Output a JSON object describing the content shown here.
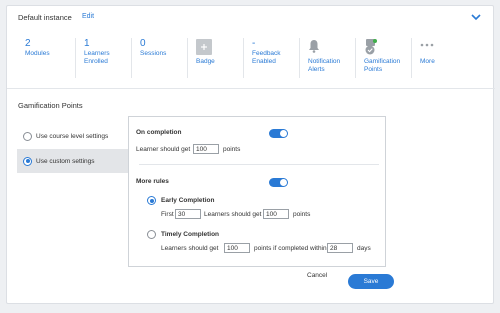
{
  "header": {
    "title": "Default instance",
    "edit_label": "Edit"
  },
  "stats": [
    {
      "value": "2",
      "label": "Modules"
    },
    {
      "value": "1",
      "label": "Learners Enrolled"
    },
    {
      "value": "0",
      "label": "Sessions"
    },
    {
      "icon": "badge-icon",
      "label": "Badge"
    },
    {
      "value": "-",
      "label": "Feedback Enabled"
    },
    {
      "icon": "bell-icon",
      "label": "Notification Alerts"
    },
    {
      "icon": "gamification-points-icon",
      "label": "Gamification Points"
    },
    {
      "icon": "more-dots-icon",
      "label": "More"
    }
  ],
  "section": {
    "title": "Gamification Points"
  },
  "left_options": [
    {
      "label": "Use course level settings",
      "selected": false
    },
    {
      "label": "Use custom settings",
      "selected": true
    }
  ],
  "panel": {
    "on_completion": {
      "title": "On completion",
      "enabled": true,
      "prefix": "Learner should get",
      "points_value": "100",
      "suffix": "points"
    },
    "more_rules": {
      "title": "More rules",
      "enabled": true,
      "early": {
        "title": "Early Completion",
        "selected": true,
        "first_label": "First",
        "first_value": "30",
        "mid_label": "Learners should get",
        "points_value": "100",
        "suffix": "points"
      },
      "timely": {
        "title": "Timely Completion",
        "selected": false,
        "prefix": "Learners should get",
        "points_value": "100",
        "mid_label": "points if completed within",
        "days_value": "28",
        "suffix": "days"
      }
    }
  },
  "actions": {
    "cancel_label": "Cancel",
    "save_label": "Save"
  },
  "colors": {
    "accent": "#2a7ad5",
    "text": "#333333",
    "border": "#e3e6ea"
  }
}
